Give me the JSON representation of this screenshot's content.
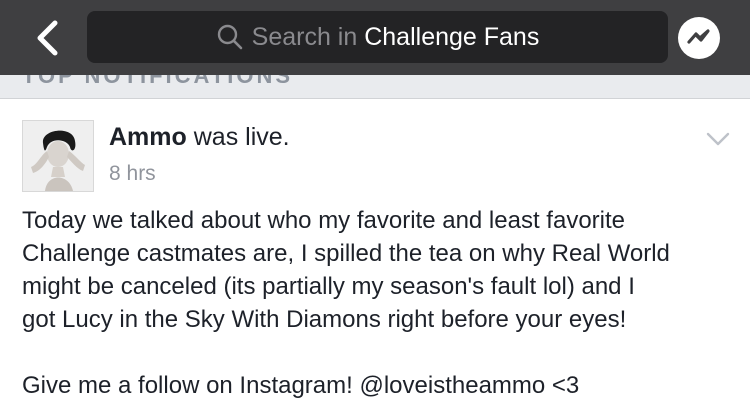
{
  "header": {
    "back_icon": "chevron-left-icon",
    "search": {
      "icon": "search-icon",
      "prefix": "Search in",
      "group_name": "Challenge Fans"
    },
    "messenger_icon": "messenger-icon"
  },
  "section": {
    "label": "TOP NOTIFICATIONS"
  },
  "post": {
    "author": "Ammo",
    "action": "was live.",
    "timestamp": "8 hrs",
    "menu_icon": "chevron-down-icon",
    "body_lines": [
      "Today we talked about who my favorite and least favorite",
      "Challenge castmates are, I spilled the tea on why Real World",
      "might be canceled (its partially my season's fault lol) and I",
      "got Lucy in the Sky With Diamons right before your eyes!"
    ],
    "cta": "Give me a follow on Instagram! @loveistheammo <3"
  },
  "colors": {
    "topbar": "#3f3f41",
    "searchbox": "#232325",
    "placeholder": "#8a8a8e",
    "text": "#1d2129",
    "muted": "#90949c",
    "strip": "#e9ebee"
  }
}
